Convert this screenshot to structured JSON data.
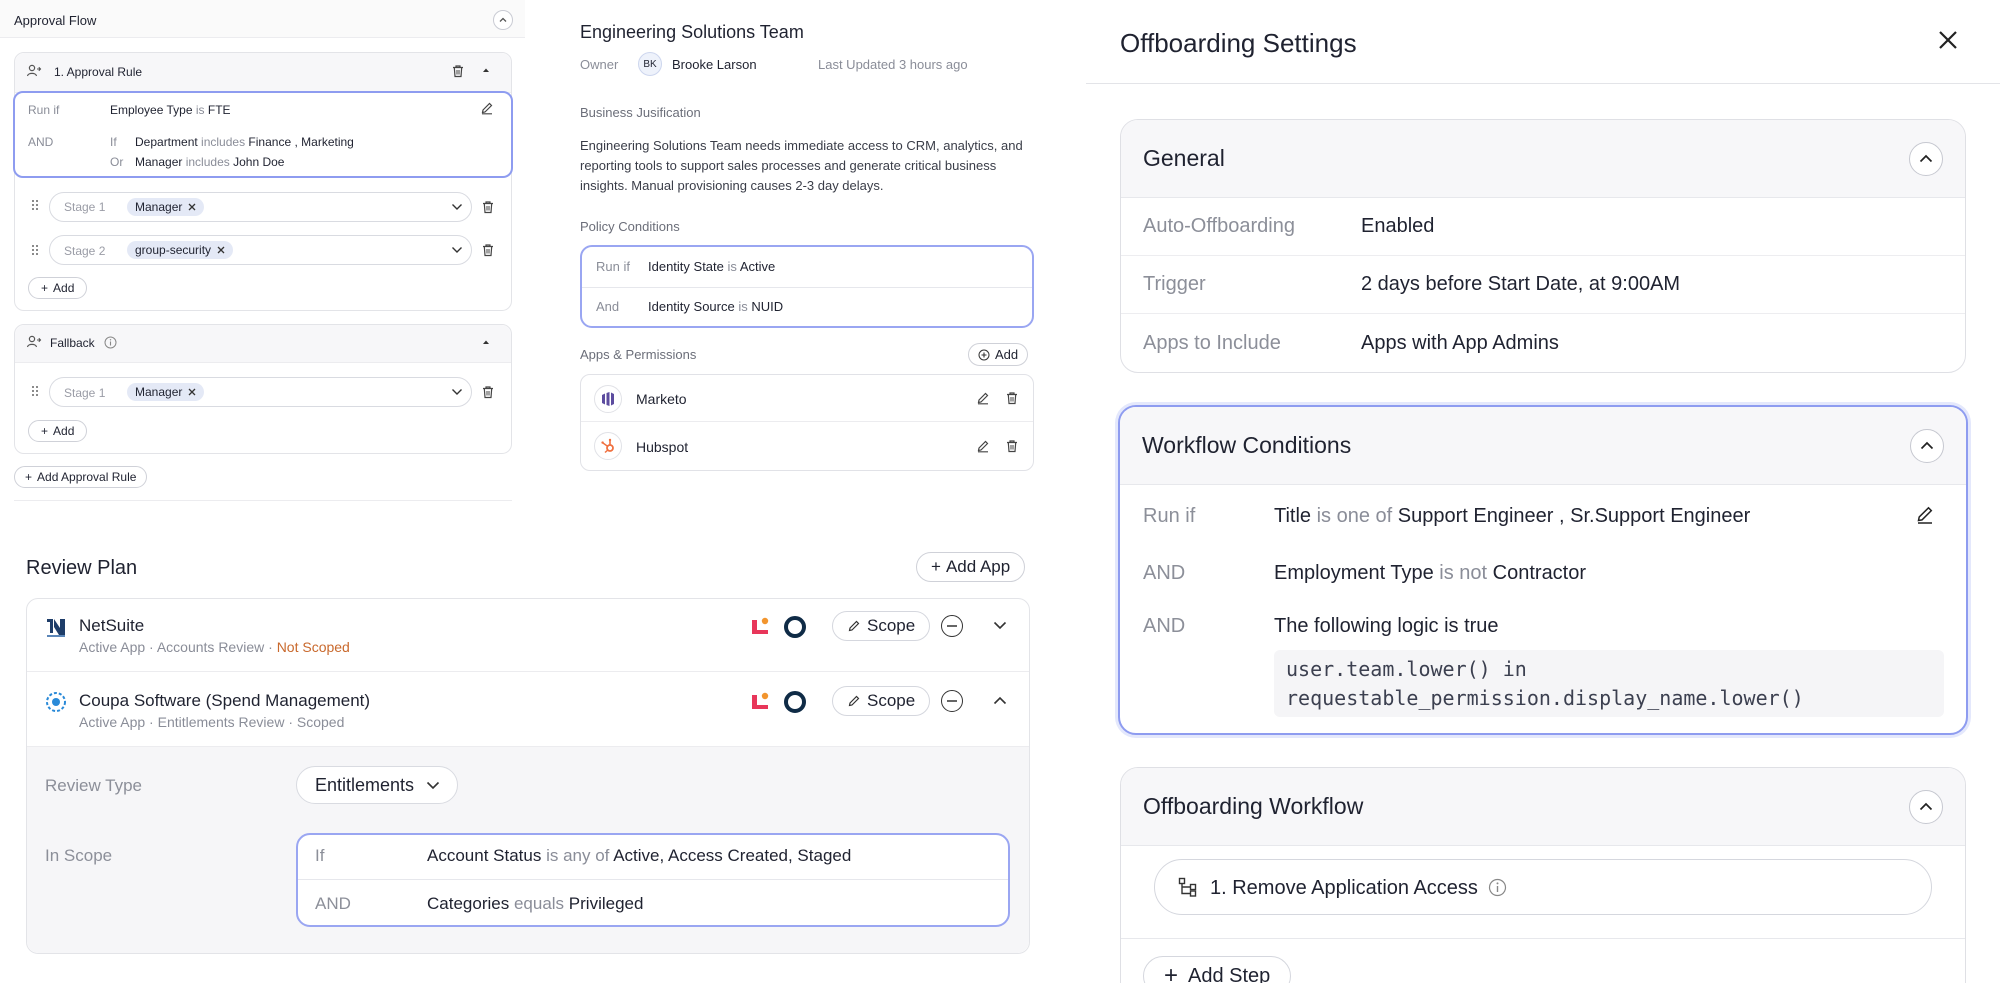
{
  "approval_flow": {
    "title": "Approval Flow",
    "rule": {
      "title": "1. Approval Rule",
      "run_if_label": "Run if",
      "run_if_field": "Employee Type",
      "run_if_op": "is",
      "run_if_value": "FTE",
      "and_label": "AND",
      "if_label": "If",
      "dept_field": "Department",
      "dept_op": "includes",
      "dept_value1": "Finance",
      "dept_sep": ",",
      "dept_value2": "Marketing",
      "or_label": "Or",
      "mgr_field": "Manager",
      "mgr_op": "includes",
      "mgr_value": "John Doe",
      "stages": [
        {
          "label": "Stage 1",
          "chip": "Manager"
        },
        {
          "label": "Stage 2",
          "chip": "group-security"
        }
      ],
      "add_label": "Add"
    },
    "fallback": {
      "title": "Fallback",
      "stages": [
        {
          "label": "Stage 1",
          "chip": "Manager"
        }
      ],
      "add_label": "Add"
    },
    "add_rule_label": "Add Approval Rule"
  },
  "team": {
    "name": "Engineering Solutions Team",
    "owner_label": "Owner",
    "owner_initials": "BK",
    "owner_name": "Brooke Larson",
    "last_updated": "Last Updated 3 hours ago",
    "justification_title": "Business Jusification",
    "justification_text": "Engineering Solutions Team needs  immediate access to CRM, analytics, and reporting tools to support sales processes and generate critical business insights. Manual provisioning causes 2-3 day delays.",
    "policy_title": "Policy Conditions",
    "policy": [
      {
        "label": "Run if",
        "field": "Identity State",
        "op": "is",
        "value": "Active"
      },
      {
        "label": "And",
        "field": "Identity Source",
        "op": "is",
        "value": "NUID"
      }
    ],
    "apps_title": "Apps & Permissions",
    "apps_add": "Add",
    "apps": [
      {
        "name": "Marketo",
        "icon": "marketo-logo"
      },
      {
        "name": "Hubspot",
        "icon": "hubspot-logo"
      }
    ]
  },
  "review_plan": {
    "title": "Review Plan",
    "add_app": "Add App",
    "apps": [
      {
        "name": "NetSuite",
        "status": "Active App",
        "review": "Accounts Review",
        "scope_status": "Not Scoped",
        "scope_btn": "Scope"
      },
      {
        "name": "Coupa Software (Spend Management)",
        "status": "Active App",
        "review": "Entitlements Review",
        "scope_status": "Scoped",
        "scope_btn": "Scope"
      }
    ],
    "sep": "·",
    "review_type_label": "Review Type",
    "review_type_value": "Entitlements",
    "in_scope_label": "In Scope",
    "scope_rows": [
      {
        "label": "If",
        "field": "Account Status",
        "op": "is any of",
        "value": "Active, Access Created, Staged"
      },
      {
        "label": "AND",
        "field": "Categories",
        "op": "equals",
        "value": "Privileged"
      }
    ]
  },
  "offboarding": {
    "title": "Offboarding Settings",
    "general": {
      "title": "General",
      "rows": [
        {
          "label": "Auto-Offboarding",
          "value": "Enabled"
        },
        {
          "label": "Trigger",
          "value": "2 days before Start Date, at 9:00AM"
        },
        {
          "label": "Apps to Include",
          "value": "Apps with App Admins"
        }
      ]
    },
    "workflow_conditions": {
      "title": "Workflow Conditions",
      "row1": {
        "label": "Run if",
        "field": "Title",
        "op": "is one of",
        "value1": "Support Engineer",
        "sep": ",",
        "value2": "Sr.Support Engineer"
      },
      "row2": {
        "label": "AND",
        "field": "Employment Type",
        "op": "is not",
        "value": "Contractor"
      },
      "row3": {
        "label": "AND",
        "text": "The following logic is true"
      },
      "code_line1": "user.team.lower() in",
      "code_line2": "requestable_permission.display_name.lower()"
    },
    "workflow": {
      "title": "Offboarding Workflow",
      "step1": "1. Remove Application Access",
      "add_step": "Add Step"
    }
  },
  "colors": {
    "accent_border": "#8e9cf0",
    "not_scoped": "#c9692d",
    "chip_bg": "#e4e9f6"
  }
}
